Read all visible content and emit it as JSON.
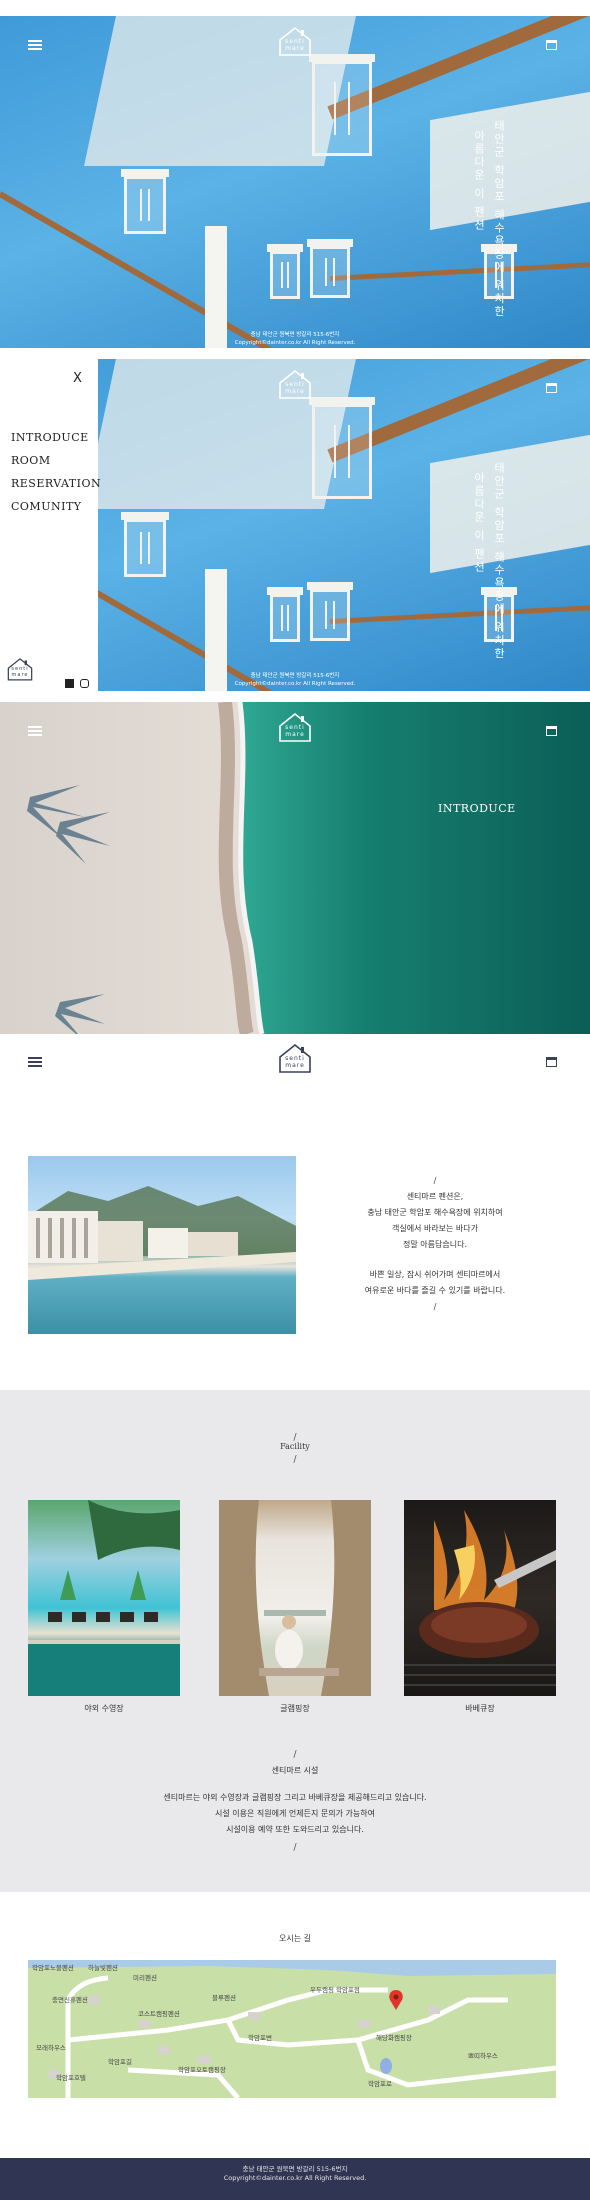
{
  "brand": {
    "logo_line1": "senti",
    "logo_line2": "mare"
  },
  "hero": {
    "vertical_text_1": "태안군 학암포 해수욕장에 위치한",
    "vertical_text_2": "아름다운 이 펜션",
    "copyright_line1": "충남 태안군 원북면 방갈리 515-6번지",
    "copyright_line2": "Copyright©dainter.co.kr All Right Reserved."
  },
  "side_menu": {
    "close_label": "X",
    "items": [
      "INTRODUCE",
      "ROOM",
      "RESERVATION",
      "COMUNITY"
    ]
  },
  "beach": {
    "title": "INTRODUCE"
  },
  "intro": {
    "slash": "/",
    "lines": [
      "센티마르 펜션은,",
      "충남 태안군 학암포 해수욕장에 위치하여",
      "객실에서 바라보는 바다가",
      "정말 아름답습니다."
    ],
    "lines2": [
      "바쁜 일상, 잠시 쉬어가며 센티마르에서",
      "여유로운 바다를 즐길 수 있기를 바랍니다."
    ]
  },
  "facility": {
    "title": "Facility",
    "slash": "/",
    "items": [
      "야외 수영장",
      "글램핑장",
      "바베큐장"
    ],
    "sub_title": "센티마르 시설",
    "desc": [
      "센티마르는 야외 수영장과 글램핑장 그리고 바베큐장을 제공해드리고 있습니다.",
      "시설 이용은 직원에게 언제든지 문의가 가능하여",
      "시설이용 예약 또한 도와드리고 있습니다."
    ]
  },
  "location": {
    "title": "오시는 길",
    "map_labels": [
      "학암포노블펜션",
      "하늘빛펜션",
      "미리펜션",
      "충면신휴펜션",
      "코스트캠핑펜션",
      "블루펜션",
      "우두캠핑 학암포점",
      "해당화캠핑장",
      "학암포변",
      "모래하우스",
      "학암포오토캠핑장",
      "학암포길",
      "학암포호텔",
      "쁘띠하우스",
      "학암포로"
    ]
  },
  "footer": {
    "line1": "충남 태안군 원북면 방갈리 515-6번지",
    "line2": "Copyright©dainter.co.kr All Right Reserved."
  },
  "colors": {
    "navy": "#2f3552",
    "sea": "#0f7a6a",
    "sky": "#4aa3dd",
    "sand": "#ddd5ce",
    "facility_bg": "#e9e9ec"
  }
}
